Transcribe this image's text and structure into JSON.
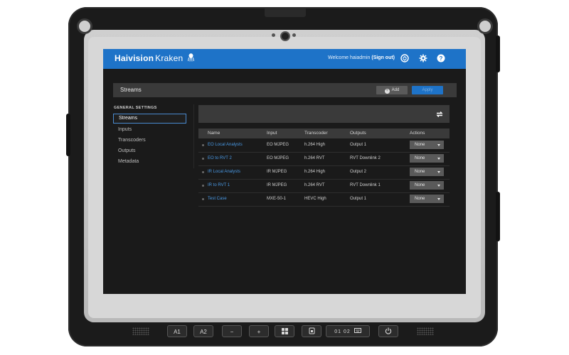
{
  "app": {
    "brand_bold": "Haivision",
    "brand_light": "Kraken",
    "welcome_prefix": "Welcome haiadmin",
    "signout": "(Sign out)",
    "accent": "#1e73c8"
  },
  "header": {
    "title": "Streams",
    "add_label": "Add",
    "apply_label": "Apply"
  },
  "sidebar": {
    "section_title": "GENERAL SETTINGS",
    "items": [
      "Streams",
      "Inputs",
      "Transcoders",
      "Outputs",
      "Metadata"
    ],
    "active": "Streams"
  },
  "table": {
    "columns": [
      "Name",
      "Input",
      "Transcoder",
      "Outputs",
      "Actions"
    ],
    "rows": [
      {
        "name": "EO Local Analysts",
        "input": "EO MJPEG",
        "transcoder": "h.264 High",
        "outputs": "Output 1",
        "action": "None"
      },
      {
        "name": "EO to RVT 2",
        "input": "EO MJPEG",
        "transcoder": "h.264 RVT",
        "outputs": "RVT Downlink 2",
        "action": "None"
      },
      {
        "name": "IR Local Analysts",
        "input": "IR MJPEG",
        "transcoder": "h.264 High",
        "outputs": "Output 2",
        "action": "None"
      },
      {
        "name": "IR to RVT 1",
        "input": "IR MJPEG",
        "transcoder": "h.264 RVT",
        "outputs": "RVT Downlink 1",
        "action": "None"
      },
      {
        "name": "Test Case",
        "input": "MXE-50-1",
        "transcoder": "HEVC High",
        "outputs": "Output 1",
        "action": "None"
      }
    ]
  },
  "hardware_keys": {
    "a1": "A1",
    "a2": "A2",
    "minus": "−",
    "plus": "+",
    "numbers": "01 02",
    "icons": [
      "windows-icon",
      "rotate-lock-icon",
      "keyboard-icon",
      "power-icon"
    ]
  }
}
